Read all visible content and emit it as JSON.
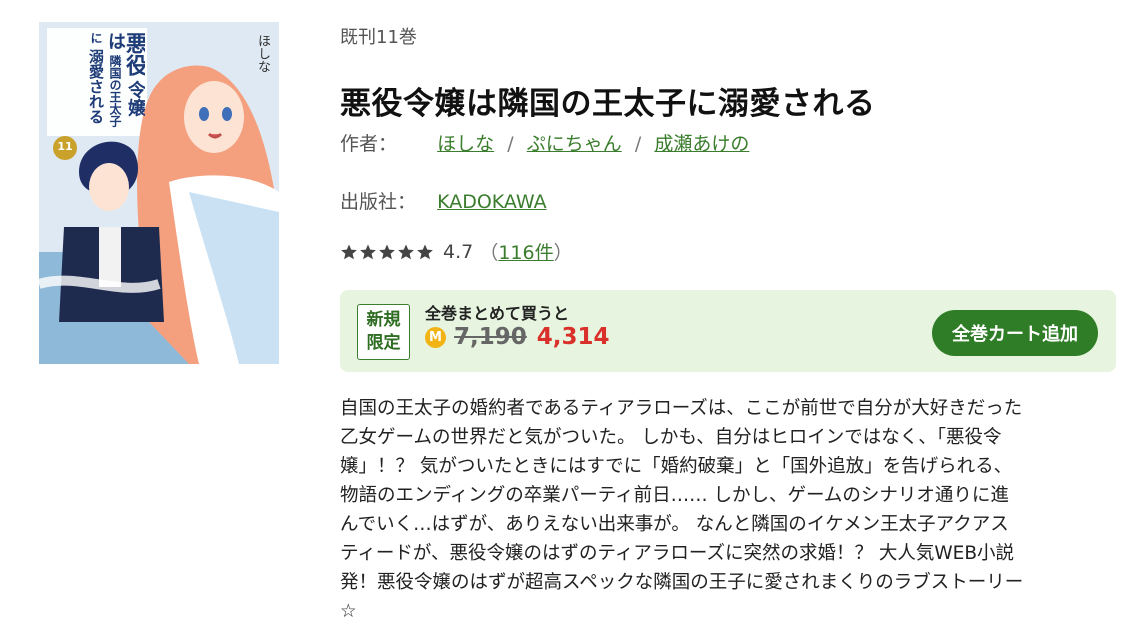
{
  "book": {
    "volumes": "既刊11巻",
    "title": "悪役令嬢は隣国の王太子に溺愛される",
    "author_label": "作者：",
    "authors": [
      "ほしな",
      "ぷにちゃん",
      "成瀬あけの"
    ],
    "publisher_label": "出版社：",
    "publisher": "KADOKAWA",
    "rating": {
      "stars": 5,
      "score": "4.7",
      "open_paren": "（",
      "count": "116件",
      "close_paren": "）"
    },
    "cover": {
      "title_vertical": [
        "悪役",
        "令嬢は",
        "隣国の王太子に",
        "溺愛される"
      ],
      "author_vertical": "ほしな",
      "volume_mark": "11"
    }
  },
  "promo": {
    "badge_line1": "新規",
    "badge_line2": "限定",
    "label": "全巻まとめて買うと",
    "coin_icon": "M",
    "old_price": "7,190",
    "new_price": "4,314",
    "button": "全巻カート追加",
    "colors": {
      "accent": "#2f7d27",
      "price": "#d9302c",
      "box": "#e7f4df"
    }
  },
  "description": [
    "自国の王太子の婚約者であるティアラローズは、ここが前世で自分が大好きだった",
    "乙女ゲームの世界だと気がついた。 しかも、自分はヒロインではなく、「悪役令",
    "嬢」！？ 気がついたときにはすでに「婚約破棄」と「国外追放」を告げられる、",
    "物語のエンディングの卒業パーティ前日…… しかし、ゲームのシナリオ通りに進",
    "んでいく…はずが、ありえない出来事が。 なんと隣国のイケメン王太子アクアス",
    "ティードが、悪役令嬢のはずのティアラローズに突然の求婚！？ 大人気WEB小説",
    "発！悪役令嬢のはずが超高スペックな隣国の王子に愛されまくりのラブストーリー",
    "☆"
  ]
}
